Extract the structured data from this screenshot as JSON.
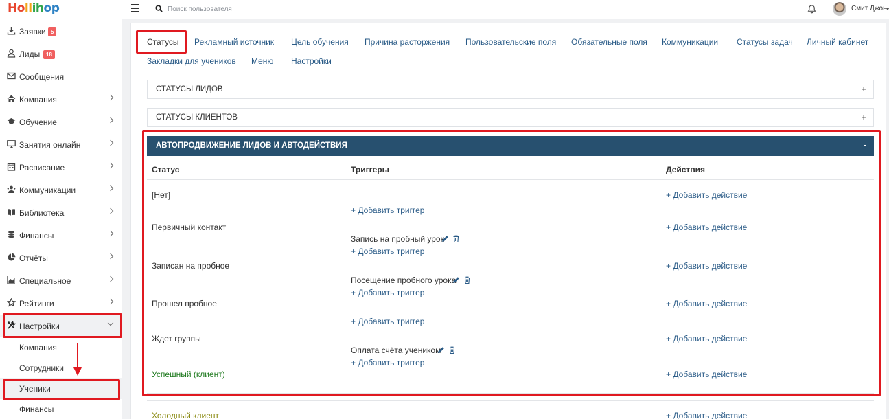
{
  "brand": {
    "part1": "Ho",
    "part2": "ll",
    "part3": "ih",
    "part4": "op"
  },
  "topbar": {
    "search_placeholder": "Поиск пользователя",
    "user_name": "Смит Джон"
  },
  "sidebar": {
    "items": [
      {
        "label": "Заявки",
        "badge": "5",
        "icon": "download-icon"
      },
      {
        "label": "Лиды",
        "badge": "18",
        "icon": "user-icon"
      },
      {
        "label": "Сообщения",
        "icon": "envelope-icon"
      },
      {
        "label": "Компания",
        "icon": "home-icon"
      },
      {
        "label": "Обучение",
        "icon": "graduation-cap-icon"
      },
      {
        "label": "Занятия онлайн",
        "icon": "monitor-icon"
      },
      {
        "label": "Расписание",
        "icon": "calendar-icon"
      },
      {
        "label": "Коммуникации",
        "icon": "communications-icon"
      },
      {
        "label": "Библиотека",
        "icon": "book-icon"
      },
      {
        "label": "Финансы",
        "icon": "coins-icon"
      },
      {
        "label": "Отчёты",
        "icon": "pie-chart-icon"
      },
      {
        "label": "Специальное",
        "icon": "area-chart-icon"
      },
      {
        "label": "Рейтинги",
        "icon": "star-icon"
      },
      {
        "label": "Настройки",
        "icon": "tools-icon"
      }
    ],
    "sub_items": [
      "Компания",
      "Сотрудники",
      "Ученики",
      "Финансы"
    ]
  },
  "tabs": {
    "row1": [
      "Статусы",
      "Рекламный источник",
      "Цель обучения",
      "Причина расторжения",
      "Пользовательские поля",
      "Обязательные поля",
      "Коммуникации",
      "Статусы задач",
      "Личный кабинет"
    ],
    "row2": [
      "Закладки для учеников",
      "Меню",
      "Настройки"
    ]
  },
  "accordions": {
    "lead_statuses": {
      "title": "СТАТУСЫ ЛИДОВ",
      "sign": "+"
    },
    "client_statuses": {
      "title": "СТАТУСЫ КЛИЕНТОВ",
      "sign": "+"
    },
    "auto": {
      "title": "АВТОПРОДВИЖЕНИЕ ЛИДОВ И АВТОДЕЙСТВИЯ",
      "sign": "-"
    }
  },
  "table": {
    "headers": {
      "status": "Статус",
      "triggers": "Триггеры",
      "actions": "Действия"
    },
    "statuses": [
      "[Нет]",
      "Первичный контакт",
      "Записан на пробное",
      "Прошел пробное",
      "Ждет группы",
      "Успешный (клиент)",
      "Холодный клиент"
    ],
    "triggers": [
      "Запись на пробный урок",
      "Посещение пробного урока",
      "Оплата счёта учеником"
    ],
    "add_trigger": "+ Добавить триггер",
    "add_action": "+ Добавить действие"
  },
  "colors": {
    "accent": "#27506f",
    "link": "#2a5b87",
    "highlight": "#e01920",
    "badge": "#f06060",
    "success": "#1f7a1f"
  }
}
